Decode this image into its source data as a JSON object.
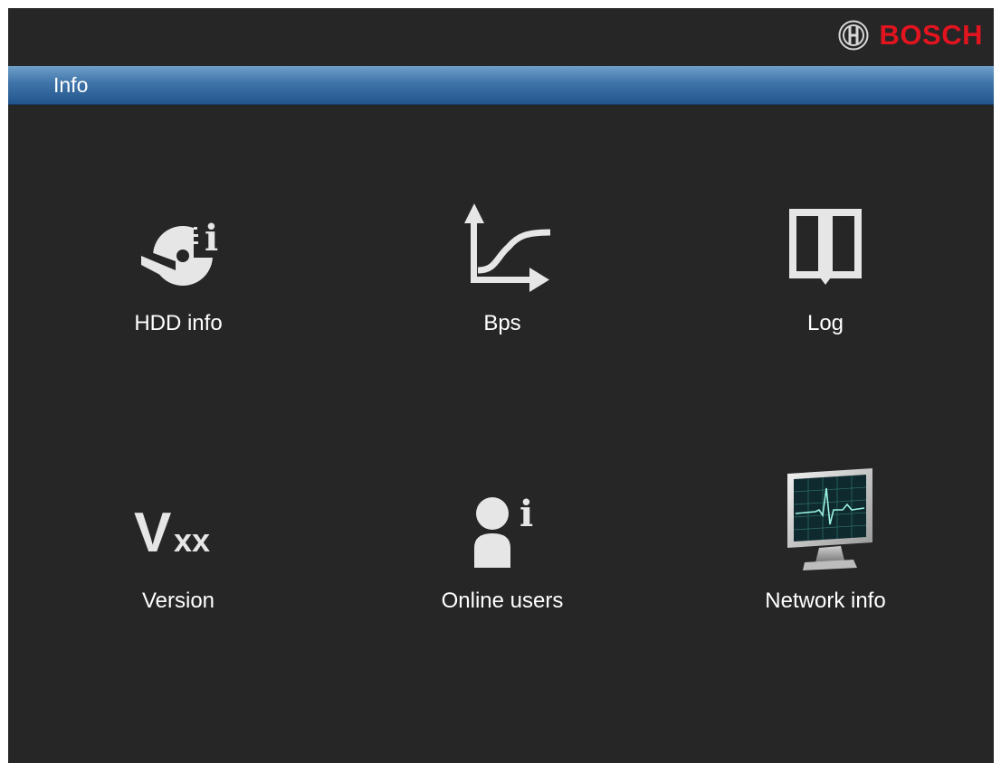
{
  "brand": {
    "name": "BOSCH",
    "color": "#e1141f"
  },
  "titlebar": {
    "title": "Info"
  },
  "menu": {
    "items": [
      {
        "label": "HDD info",
        "icon": "hdd-info-icon"
      },
      {
        "label": "Bps",
        "icon": "bps-graph-icon"
      },
      {
        "label": "Log",
        "icon": "log-book-icon"
      },
      {
        "label": "Version",
        "icon": "version-vxx-icon"
      },
      {
        "label": "Online users",
        "icon": "online-users-icon"
      },
      {
        "label": "Network info",
        "icon": "network-monitor-icon"
      }
    ]
  },
  "icons": {
    "info_glyph": "i",
    "version_big": "V",
    "version_small": "xx"
  },
  "colors": {
    "background": "#262626",
    "titlebar": "#3f74a9",
    "icon": "#e8e8e8"
  }
}
